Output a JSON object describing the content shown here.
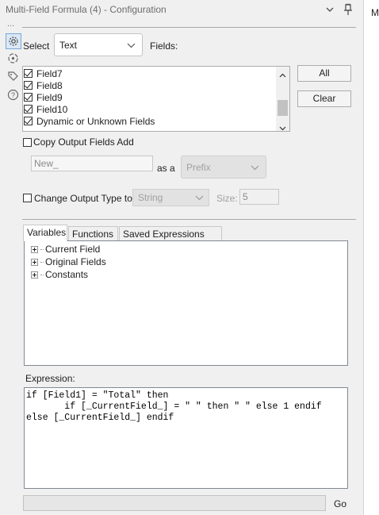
{
  "window": {
    "title": "Multi-Field Formula (4) - Configuration",
    "right_strip_text": "M"
  },
  "sidebar": {
    "more": "...",
    "icons": [
      "settings-icon",
      "connection-icon",
      "tag-icon",
      "help-icon"
    ]
  },
  "select_row": {
    "select_label": "Select",
    "type_value": "Text",
    "fields_label": "Fields:"
  },
  "fields_list": [
    {
      "label": "Field7",
      "checked": true
    },
    {
      "label": "Field8",
      "checked": true
    },
    {
      "label": "Field9",
      "checked": true
    },
    {
      "label": "Field10",
      "checked": true
    },
    {
      "label": "Dynamic or Unknown Fields",
      "checked": true
    }
  ],
  "buttons": {
    "all": "All",
    "clear": "Clear",
    "go": "Go"
  },
  "copy_output": {
    "label": "Copy Output Fields Add",
    "name_value": "New_",
    "as_a": "as a",
    "position_value": "Prefix"
  },
  "change_type": {
    "label": "Change Output Type to",
    "type_value": "String",
    "size_label": "Size:",
    "size_value": "5"
  },
  "tabs": [
    "Variables",
    "Functions",
    "Saved Expressions"
  ],
  "tree": [
    "Current Field",
    "Original Fields",
    "Constants"
  ],
  "expression": {
    "label": "Expression:",
    "code": "if [Field1] = \"Total\" then\n       if [_CurrentField_] = \" \" then \" \" else 1 endif\nelse [_CurrentField_] endif"
  },
  "status_bar": {
    "text": ""
  }
}
